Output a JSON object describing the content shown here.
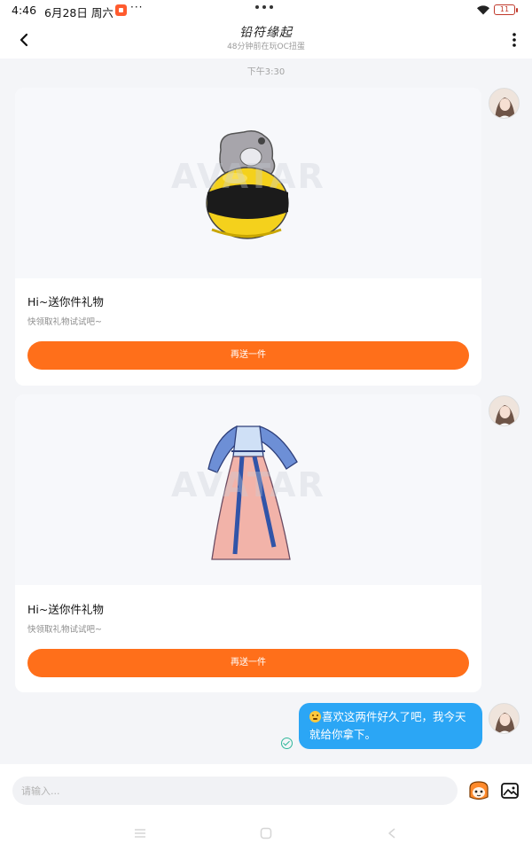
{
  "status_bar": {
    "time": "4:46",
    "date": "6月28日 周六",
    "more": "···",
    "battery": "11"
  },
  "header": {
    "title": "铅符缘起",
    "subtitle": "48分钟前在玩OC扭蛋"
  },
  "timestamp": "下午3:30",
  "gifts": [
    {
      "title": "Hi~送你件礼物",
      "description": "快领取礼物试试吧~",
      "button_label": "再送一件",
      "watermark": "AVATAR"
    },
    {
      "title": "Hi~送你件礼物",
      "description": "快领取礼物试试吧~",
      "button_label": "再送一件",
      "watermark": "AVATAR"
    }
  ],
  "outgoing_message": {
    "text": "喜欢这两件好久了吧，我今天就给你拿下。"
  },
  "input": {
    "placeholder": "请输入..."
  },
  "colors": {
    "accent_orange": "#ff6f1a",
    "bubble_blue": "#2ba6f5",
    "background": "#f4f5f8"
  }
}
